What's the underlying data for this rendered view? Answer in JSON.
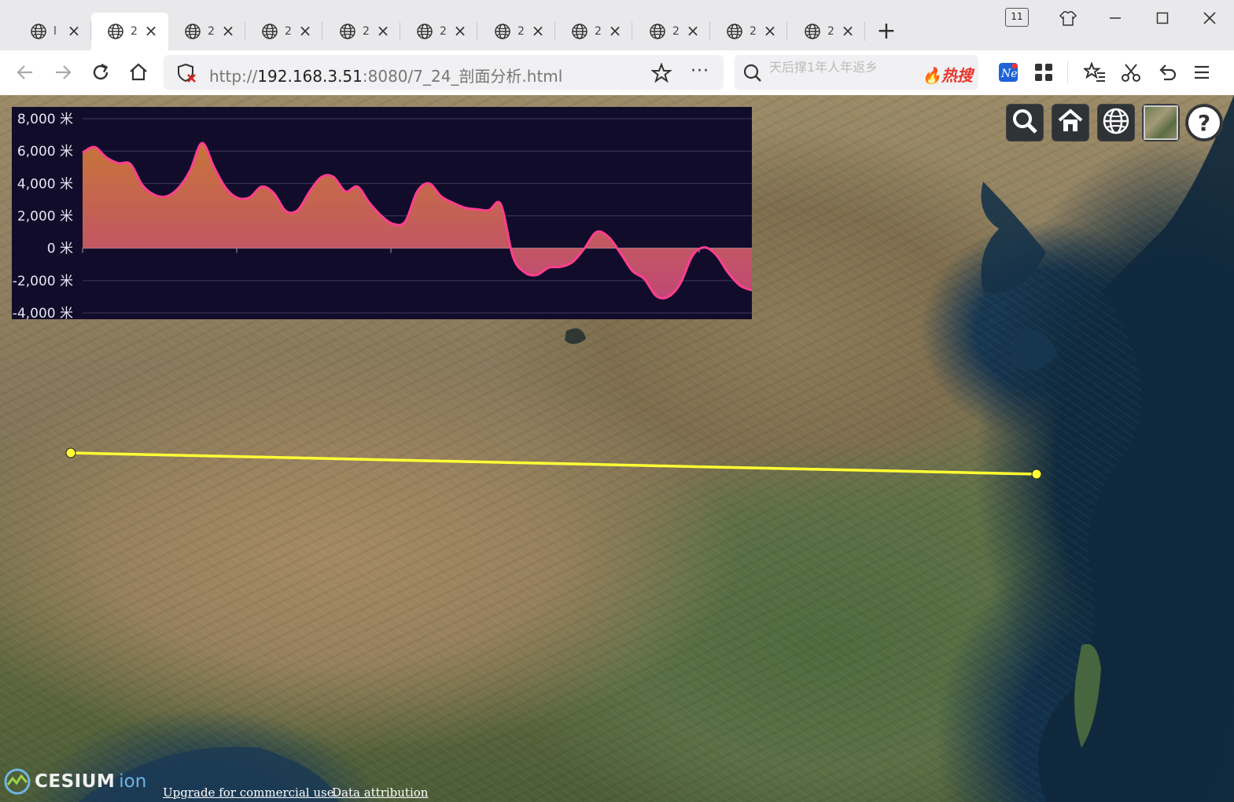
{
  "browser": {
    "tabs": [
      {
        "title": "l",
        "active": false
      },
      {
        "title": "2",
        "active": true
      },
      {
        "title": "2",
        "active": false
      },
      {
        "title": "2",
        "active": false
      },
      {
        "title": "2",
        "active": false
      },
      {
        "title": "2",
        "active": false
      },
      {
        "title": "2",
        "active": false
      },
      {
        "title": "2",
        "active": false
      },
      {
        "title": "2",
        "active": false
      },
      {
        "title": "2",
        "active": false
      },
      {
        "title": "2",
        "active": false
      }
    ],
    "new_tab_label": "+",
    "tab_count_badge": "11",
    "url_host": "192.168.3.51",
    "url_prefix": "http://",
    "url_path": ":8080/7_24_剖面分析.html",
    "search_placeholder": "天后撑1年人年返乡",
    "hot_search_label": "热搜"
  },
  "chart_data": {
    "type": "area",
    "title": "",
    "xlabel": "",
    "ylabel": "",
    "ylim": [
      -4000,
      8000
    ],
    "yticks": [
      8000,
      6000,
      4000,
      2000,
      0,
      -2000,
      -4000
    ],
    "ytick_labels": [
      "8,000 米",
      "6,000 米",
      "4,000 米",
      "2,000 米",
      "0 米",
      "-2,000 米",
      "-4,000 米"
    ],
    "grid": true,
    "series": [
      {
        "values": [
          5900,
          6250,
          5600,
          5250,
          5200,
          3900,
          3300,
          3200,
          3700,
          4800,
          6500,
          5000,
          3700,
          3100,
          3150,
          3800,
          3400,
          2300,
          2350,
          3500,
          4400,
          4400,
          3500,
          3800,
          2800,
          2000,
          1500,
          1650,
          3500,
          4000,
          3200,
          2800,
          2500,
          2400,
          2350,
          2700,
          -500,
          -1500,
          -1650,
          -1200,
          -1150,
          -850,
          0,
          1000,
          700,
          -300,
          -1400,
          -1900,
          -2950,
          -3000,
          -2200,
          -500,
          50,
          -400,
          -1500,
          -2300,
          -2600
        ]
      }
    ],
    "colors": {
      "top": "#d17a3a",
      "bottom": "#c94b7a",
      "line": "#ff3f8e"
    }
  },
  "map": {
    "profile_line_color": "#ffff33",
    "credits": {
      "logo_word": "CESIUM",
      "logo_suffix": "ion",
      "upgrade_link": "Upgrade for commercial use.",
      "attribution_link": "Data attribution"
    },
    "buttons": [
      "search-icon",
      "home-icon",
      "globe-icon",
      "imagery-layer-icon",
      "help-icon"
    ],
    "help_label": "?"
  }
}
